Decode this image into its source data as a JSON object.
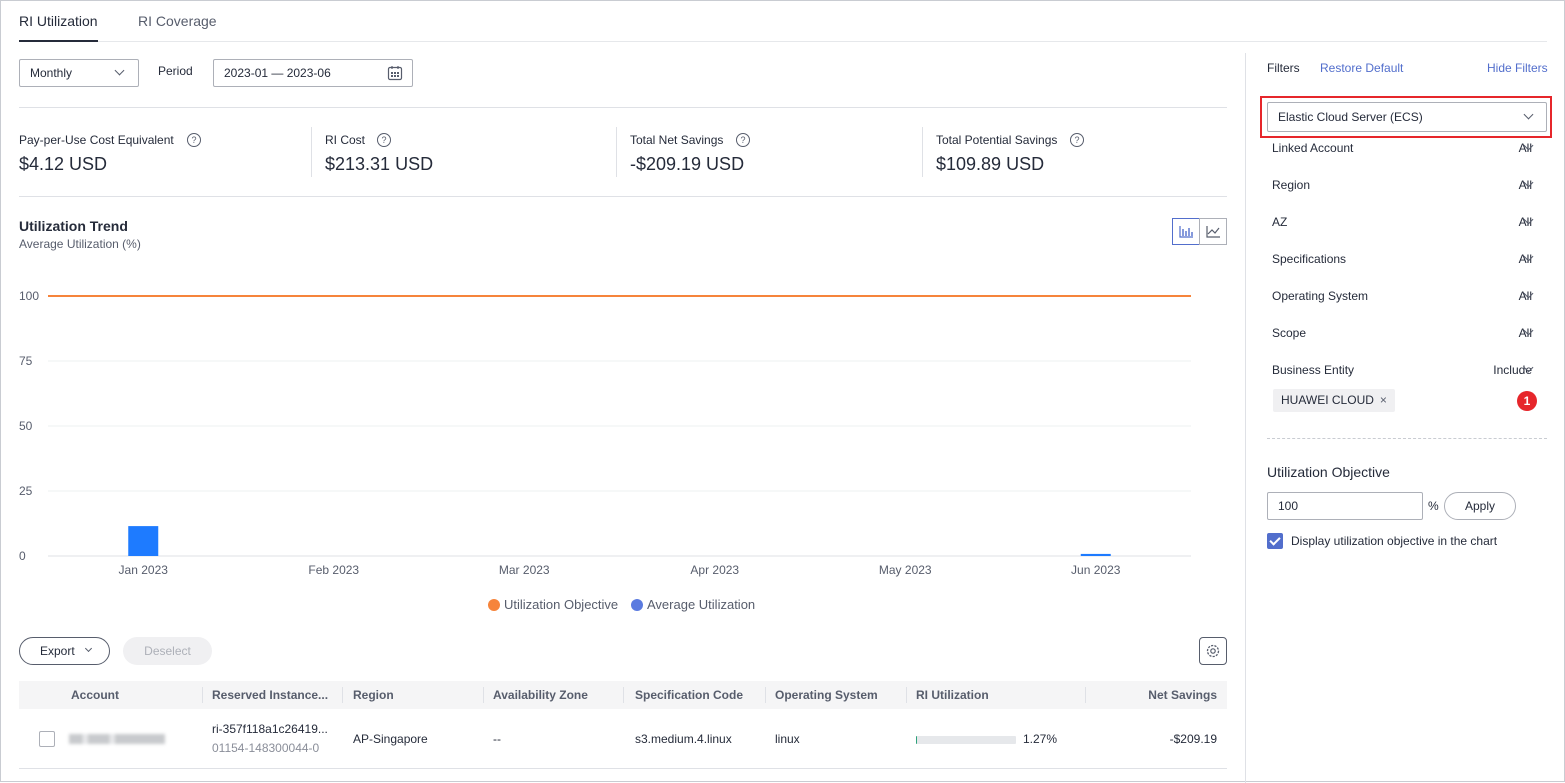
{
  "tabs": [
    {
      "label": "RI Utilization",
      "active": true
    },
    {
      "label": "RI Coverage",
      "active": false
    }
  ],
  "controls": {
    "granularity": "Monthly",
    "period_label": "Period",
    "period_value": "2023-01 — 2023-06"
  },
  "summary": [
    {
      "label": "Pay-per-Use Cost Equivalent",
      "value": "$4.12 USD"
    },
    {
      "label": "RI Cost",
      "value": "$213.31 USD"
    },
    {
      "label": "Total Net Savings",
      "value": "-$209.19 USD"
    },
    {
      "label": "Total Potential Savings",
      "value": "$109.89 USD"
    }
  ],
  "chart": {
    "title": "Utilization Trend",
    "subtitle": "Average Utilization (%)"
  },
  "chart_data": {
    "type": "bar",
    "title": "Utilization Trend",
    "ylabel": "Average Utilization (%)",
    "categories": [
      "Jan 2023",
      "Feb 2023",
      "Mar 2023",
      "Apr 2023",
      "May 2023",
      "Jun 2023"
    ],
    "y_ticks": [
      0,
      25,
      50,
      75,
      100
    ],
    "ylim": [
      0,
      100
    ],
    "grid": true,
    "legend_position": "bottom",
    "series": [
      {
        "name": "Average Utilization",
        "kind": "bar",
        "color": "#1e7bff",
        "values": [
          11.5,
          0,
          0,
          0,
          0,
          0.8
        ]
      },
      {
        "name": "Utilization Objective",
        "kind": "line",
        "color": "#f6843b",
        "values": [
          100,
          100,
          100,
          100,
          100,
          100
        ]
      }
    ]
  },
  "legend": [
    {
      "name": "Utilization Objective",
      "color": "#f6843b"
    },
    {
      "name": "Average Utilization",
      "color": "#5b7be0"
    }
  ],
  "actions": {
    "export": "Export",
    "deselect": "Deselect"
  },
  "table": {
    "columns": [
      "Account",
      "Reserved Instance...",
      "Region",
      "Availability Zone",
      "Specification Code",
      "Operating System",
      "RI Utilization",
      "Net Savings"
    ],
    "rows": [
      {
        "ri_id": "ri-357f118a1c26419...",
        "ri_sub": "01154-148300044-0",
        "region": "AP-Singapore",
        "az": "--",
        "spec": "s3.medium.4.linux",
        "os": "linux",
        "utilization": "1.27%",
        "utilization_value": 1.27,
        "net_savings": "-$209.19"
      }
    ]
  },
  "filters": {
    "title": "Filters",
    "restore": "Restore Default",
    "hide": "Hide Filters",
    "service": "Elastic Cloud Server (ECS)",
    "items": [
      {
        "label": "Linked Account",
        "value": "All"
      },
      {
        "label": "Region",
        "value": "All"
      },
      {
        "label": "AZ",
        "value": "All"
      },
      {
        "label": "Specifications",
        "value": "All"
      },
      {
        "label": "Operating System",
        "value": "All"
      },
      {
        "label": "Scope",
        "value": "All"
      },
      {
        "label": "Business Entity",
        "value": "Include"
      }
    ],
    "tag": "HUAWEI CLOUD",
    "badge_count": "1"
  },
  "objective": {
    "title": "Utilization Objective",
    "value": "100",
    "unit": "%",
    "apply": "Apply",
    "display_label": "Display utilization objective in the chart"
  }
}
